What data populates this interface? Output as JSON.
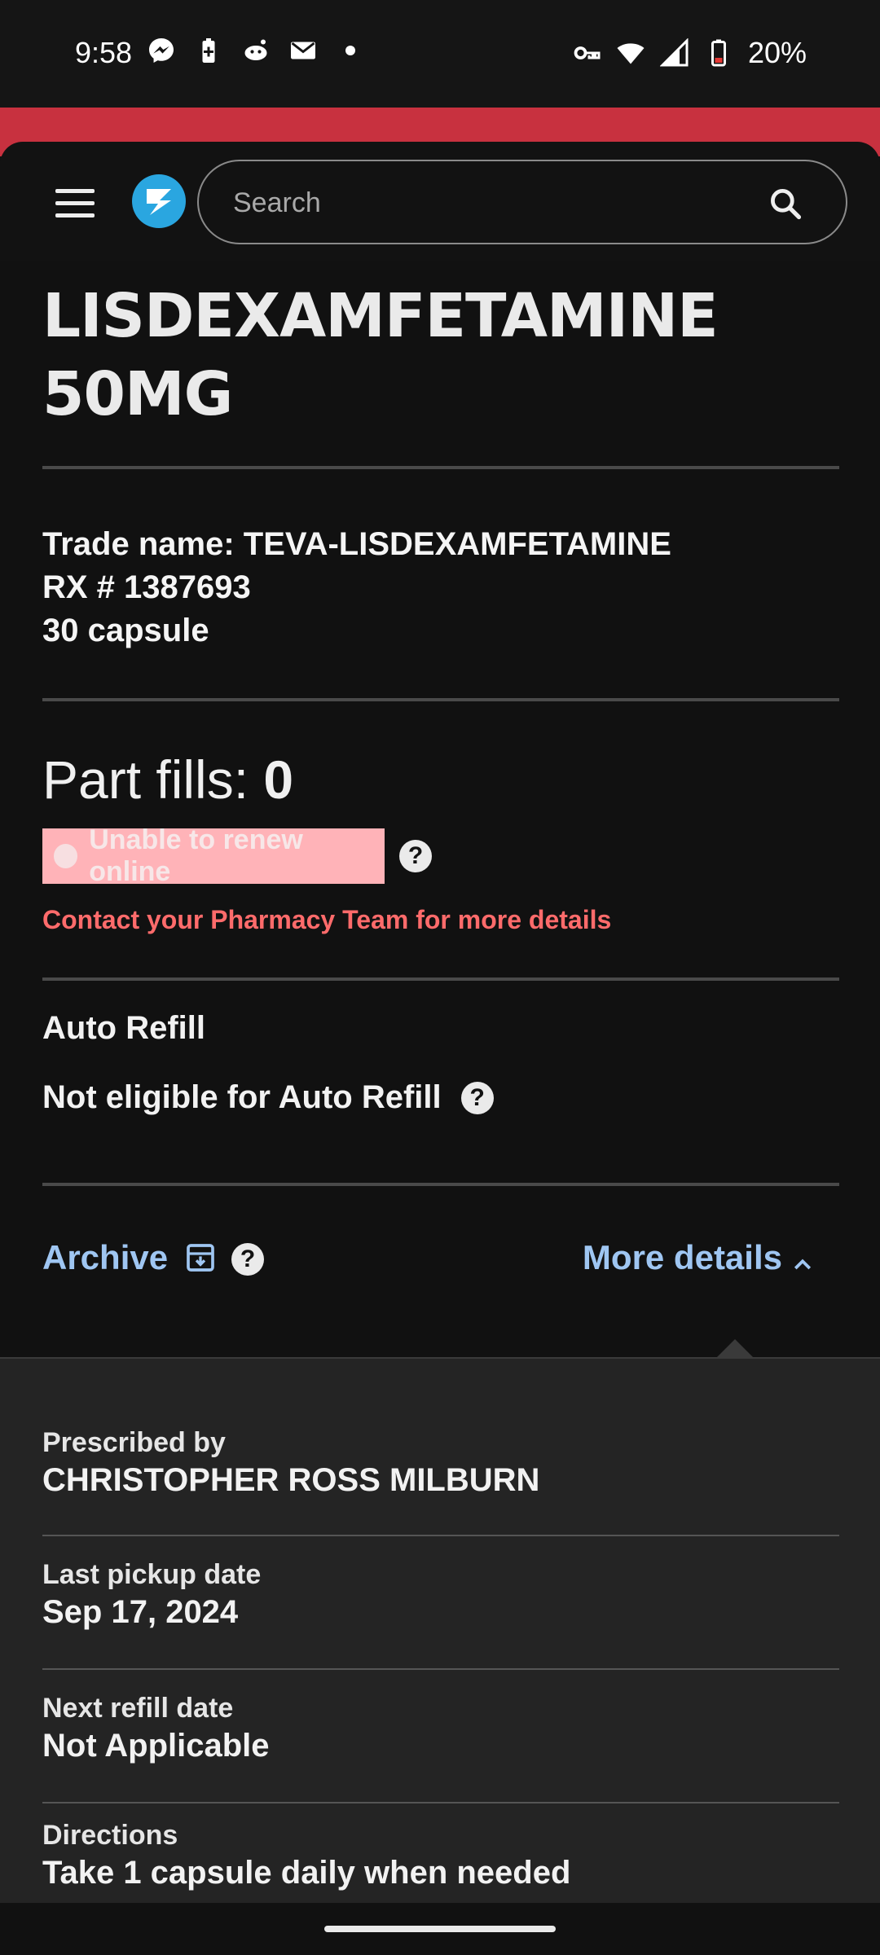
{
  "status_bar": {
    "time": "9:58",
    "battery": "20%",
    "icons_left": [
      "messenger-icon",
      "battery-saver-icon",
      "reddit-icon",
      "mail-icon",
      "dot-icon"
    ],
    "icons_right": [
      "vpn-key-icon",
      "wifi-icon",
      "signal-icon",
      "battery-low-icon"
    ]
  },
  "header": {
    "search_placeholder": "Search"
  },
  "prescription": {
    "title_line1": "LISDEXAMFETAMINE",
    "title_line2": "50MG",
    "trade_name": "Trade name: TEVA-LISDEXAMFETAMINE",
    "rx_number": "RX  # 1387693",
    "quantity": "30 capsule",
    "part_fills_label": "Part fills: ",
    "part_fills_value": "0",
    "renew_status": "Unable to renew online",
    "contact_message": "Contact your Pharmacy Team for more details",
    "auto_refill_title": "Auto Refill",
    "auto_refill_status": "Not eligible for Auto Refill"
  },
  "actions": {
    "archive_label": "Archive",
    "more_details_label": "More details"
  },
  "details": {
    "prescribed_by_label": "Prescribed by",
    "prescribed_by_value": "CHRISTOPHER ROSS MILBURN",
    "last_pickup_label": "Last pickup date",
    "last_pickup_value": "Sep 17, 2024",
    "next_refill_label": "Next refill date",
    "next_refill_value": "Not Applicable",
    "directions_label": "Directions",
    "directions_value": "Take 1 capsule daily when needed"
  },
  "colors": {
    "brand_red": "#c8313f",
    "link_blue": "#9fc6f2",
    "warning_text": "#ff6b6b",
    "badge_pink": "#ffb3b8"
  }
}
